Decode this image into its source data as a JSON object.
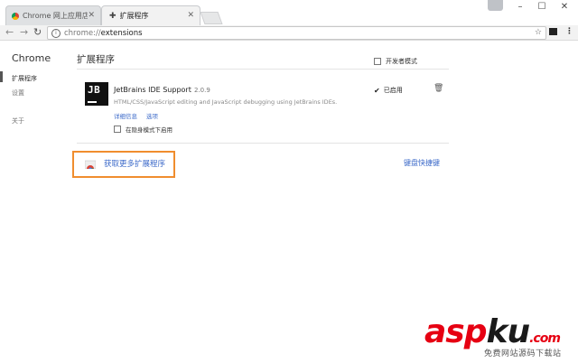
{
  "window": {
    "tabs": [
      {
        "label": "Chrome 网上应用店 - Je",
        "active": false
      },
      {
        "label": "扩展程序",
        "active": true
      }
    ],
    "controls": {
      "minimize": "–",
      "maximize": "☐",
      "close": "✕"
    }
  },
  "toolbar": {
    "back": "←",
    "forward": "→",
    "reload": "↻",
    "url_scheme": "chrome://",
    "url_path": "extensions",
    "star": "☆",
    "menu": "⋮"
  },
  "sidebar": {
    "title": "Chrome",
    "items": [
      {
        "label": "扩展程序",
        "selected": true
      },
      {
        "label": "设置",
        "selected": false
      },
      {
        "label": "关于",
        "selected": false
      }
    ]
  },
  "main": {
    "title": "扩展程序",
    "developer_mode_label": "开发者模式",
    "extension": {
      "icon_text": "JB",
      "name": "JetBrains IDE Support",
      "version": "2.0.9",
      "description": "HTML/CSS/JavaScript editing and JavaScript debugging using JetBrains IDEs.",
      "details_link": "详细信息",
      "options_link": "选项",
      "incognito_label": "在隐身模式下启用",
      "enabled_label": "已启用",
      "enabled": true
    },
    "get_more_label": "获取更多扩展程序",
    "shortcuts_label": "键盘快捷键"
  },
  "watermark": {
    "main_red": "asp",
    "main_dark": "ku",
    "suffix": ".com",
    "sub": "免费网站源码下载站"
  },
  "colors": {
    "accent_link": "#3c6ac9",
    "highlight_border": "#f08d2e",
    "watermark_red": "#e60012"
  }
}
